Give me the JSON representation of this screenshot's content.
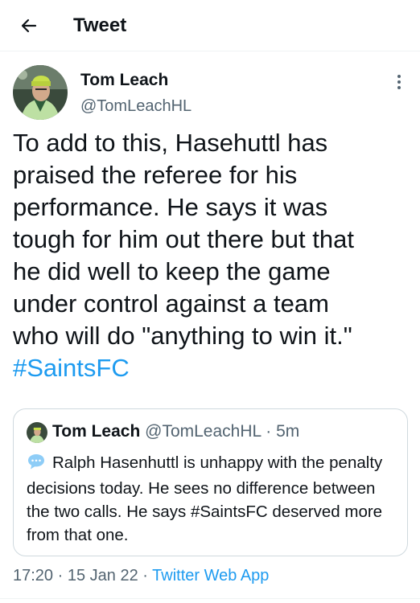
{
  "header": {
    "title": "Tweet"
  },
  "tweet": {
    "author_name": "Tom Leach",
    "author_handle": "@TomLeachHL",
    "text": "To add to this, Hasehuttl has\npraised the referee for his\nperformance. He says it was\ntough for him out there but that\nhe did well to keep the game\nunder control against a team\nwho will do \"anything to win it.\"",
    "hashtag": "#SaintsFC",
    "time": "17:20",
    "date": "15 Jan 22",
    "source": "Twitter Web App",
    "separator": "·"
  },
  "quote": {
    "author_name": "Tom Leach",
    "author_handle": "@TomLeachHL",
    "separator": "·",
    "age": "5m",
    "text": "Ralph Hasenhuttl is unhappy with the penalty decisions today. He sees no difference between the two calls. He says #SaintsFC deserved more from that one."
  },
  "colors": {
    "link": "#1d9bf0",
    "secondary": "#536471",
    "border": "#cfd9de"
  },
  "icons": {
    "back": "arrow-left-icon",
    "more": "more-vertical-icon",
    "emoji": "speech-balloon-icon"
  }
}
